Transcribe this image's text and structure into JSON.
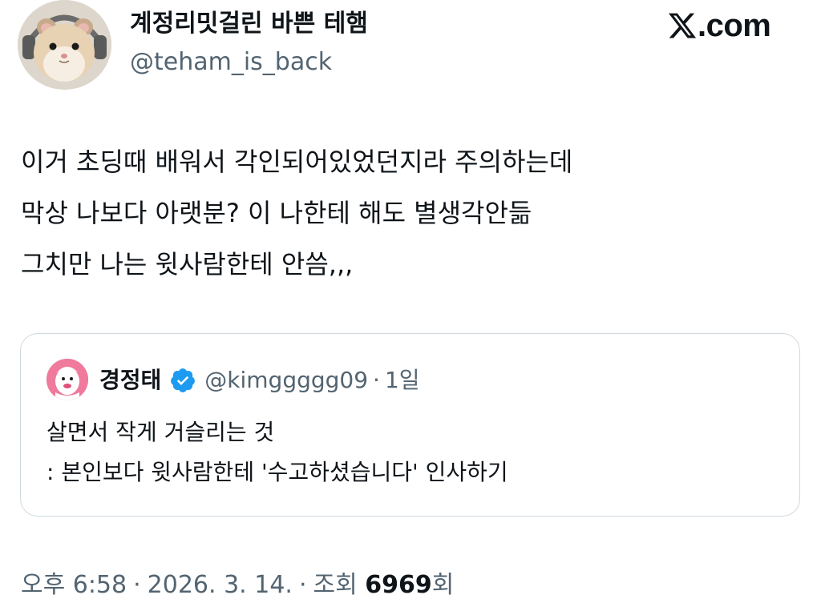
{
  "author": {
    "display_name": "계정리밋걸린 바쁜 테햄",
    "handle": "@teham_is_back",
    "avatar_icon": "hamster-avatar-icon"
  },
  "site": {
    "domain": ".com",
    "logo_icon": "x-logo-icon"
  },
  "tweet": {
    "lines": [
      "이거 초딩때 배워서 각인되어있었던지라 주의하는데",
      "막상 나보다 아랫분? 이 나한테 해도 별생각안듦",
      "그치만 나는 윗사람한테 안씀,,,"
    ]
  },
  "quote": {
    "display_name": "경정태",
    "handle": "@kimggggg09",
    "separator": "·",
    "time": "1일",
    "verified_icon": "verified-badge-icon",
    "verified_color": "#1d9bf0",
    "avatar_color": "#f07a9c",
    "lines": [
      "살면서 작게 거슬리는 것",
      ": 본인보다 윗사람한테 '수고하셨습니다' 인사하기"
    ]
  },
  "meta": {
    "time": "오후 6:58",
    "sep1": "·",
    "date": "2026. 3. 14.",
    "sep2": "·",
    "views_label_prefix": "조회",
    "views_count": "6969",
    "views_label_suffix": "회"
  },
  "colors": {
    "text_primary": "#0f1419",
    "text_secondary": "#536471",
    "border": "#cfd9de"
  }
}
